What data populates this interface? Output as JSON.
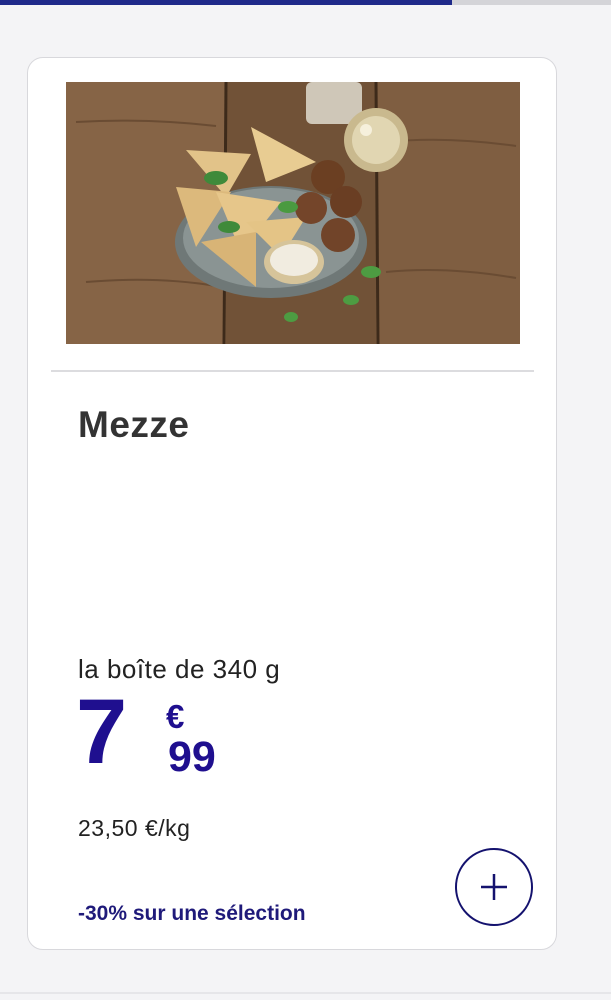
{
  "progress": {
    "fraction": 0.74
  },
  "product": {
    "title": "Mezze",
    "quantity": "la boîte de 340 g",
    "price": {
      "euros": "7",
      "currency": "€",
      "cents": "99"
    },
    "unit_price": "23,50 €/kg",
    "promo": "-30% sur une sélection",
    "image_icon": "mezze-platter-photo"
  },
  "actions": {
    "add_icon": "plus-icon"
  },
  "colors": {
    "price": "#1f0f8f",
    "accent": "#1f2a8a",
    "promo": "#1f1a7a"
  }
}
